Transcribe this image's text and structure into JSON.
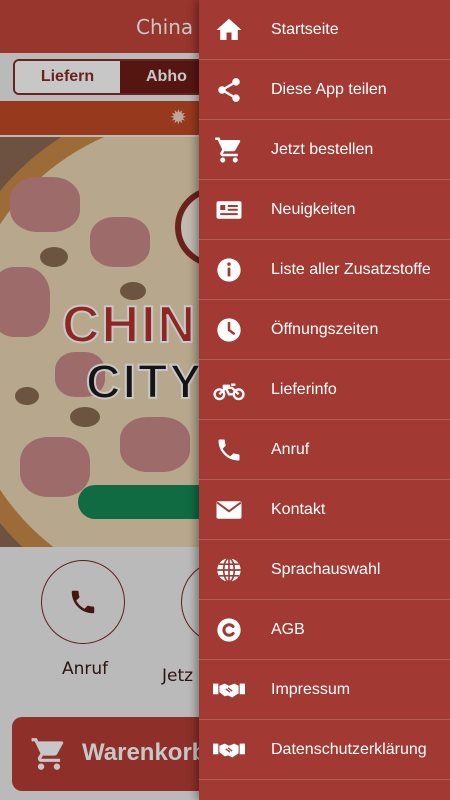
{
  "app": {
    "title": "China W",
    "order_mode": {
      "options": [
        "Liefern",
        "Abho"
      ],
      "selected": "Abho"
    },
    "quick_actions": [
      {
        "label": "Anruf",
        "icon": "phone-icon"
      },
      {
        "label": "Jetz",
        "icon": "cart-icon"
      }
    ],
    "logo_line1": "CHIN",
    "logo_line2": "CITY",
    "cart_button_label": "Warenkorb"
  },
  "drawer": {
    "items": [
      {
        "label": "Startseite",
        "icon": "home-icon"
      },
      {
        "label": "Diese App teilen",
        "icon": "share-icon"
      },
      {
        "label": "Jetzt bestellen",
        "icon": "cart-icon"
      },
      {
        "label": "Neuigkeiten",
        "icon": "newspaper-icon"
      },
      {
        "label": "Liste aller Zusatzstoffe",
        "icon": "info-icon"
      },
      {
        "label": "Öffnungszeiten",
        "icon": "clock-icon"
      },
      {
        "label": "Lieferinfo",
        "icon": "motorcycle-icon"
      },
      {
        "label": "Anruf",
        "icon": "phone-icon"
      },
      {
        "label": "Kontakt",
        "icon": "envelope-icon"
      },
      {
        "label": "Sprachauswahl",
        "icon": "globe-icon"
      },
      {
        "label": "AGB",
        "icon": "copyright-icon"
      },
      {
        "label": "Impressum",
        "icon": "handshake-icon"
      },
      {
        "label": "Datenschutzerklärung",
        "icon": "handshake-icon"
      }
    ]
  },
  "colors": {
    "header": "#c3443a",
    "drawer": "#a23a33",
    "segment_active": "#6e1d18",
    "banner": "#c24a24",
    "cart_button": "#b73d35",
    "order_button": "#168a55"
  }
}
